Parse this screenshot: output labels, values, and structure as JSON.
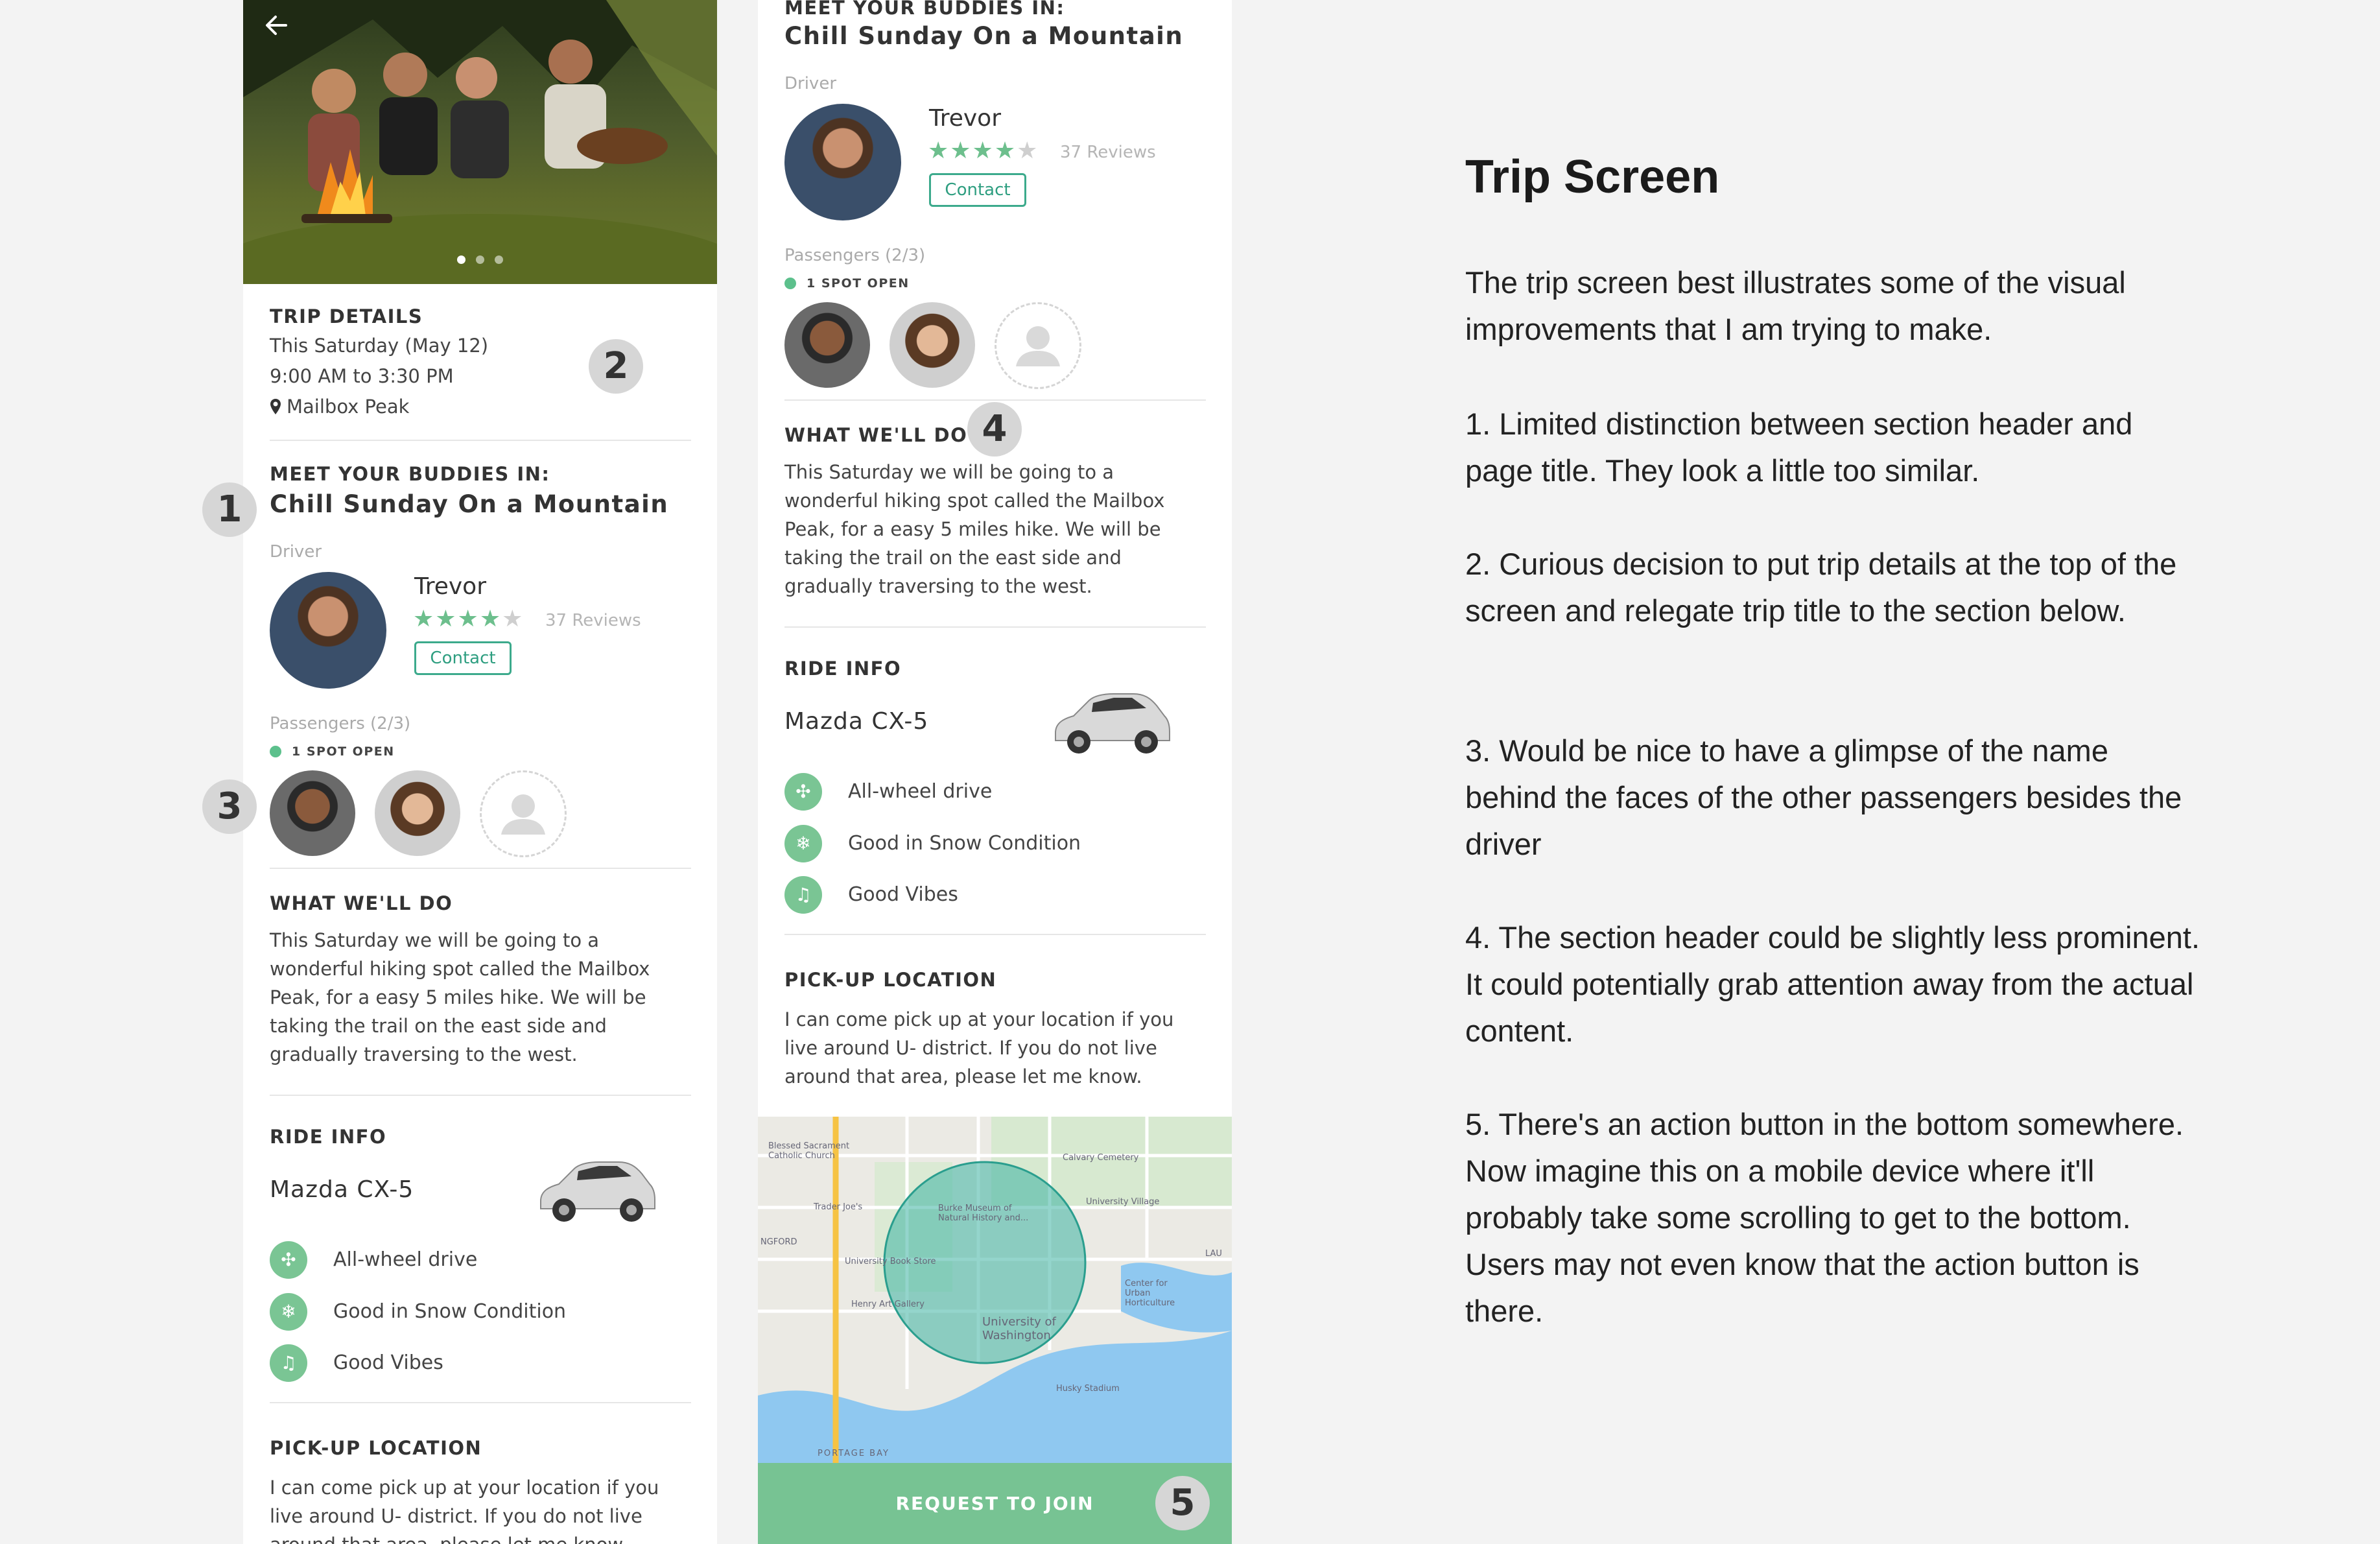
{
  "trip": {
    "details_header": "TRIP DETAILS",
    "date": "This Saturday (May 12)",
    "time": "9:00 AM to 3:30 PM",
    "location": "Mailbox Peak",
    "meet_header": "MEET YOUR BUDDIES IN:",
    "title": "Chill Sunday On a Mountain"
  },
  "driver": {
    "label": "Driver",
    "name": "Trevor",
    "stars_on": "★★★★",
    "stars_off": "★",
    "rating": 4,
    "reviews": "37 Reviews",
    "contact": "Contact"
  },
  "passengers": {
    "label": "Passengers (2/3)",
    "spot": "1 SPOT OPEN"
  },
  "what": {
    "header": "WHAT WE'LL DO",
    "lines": [
      "This Saturday we will be going to a",
      "wonderful hiking spot called the Mailbox",
      "Peak, for a easy 5 miles hike. We will be",
      "taking the trail on the east side and",
      "gradually traversing to the west."
    ]
  },
  "ride": {
    "header": "RIDE INFO",
    "car": "Mazda CX-5",
    "features": [
      "All-wheel drive",
      "Good in Snow Condition",
      "Good Vibes"
    ],
    "feature_icons": [
      "drive-icon",
      "snowflake-icon",
      "music-note-icon"
    ]
  },
  "pickup": {
    "header": "PICK-UP LOCATION",
    "lines": [
      "I can come pick up at your location if you",
      "live around U- district. If you do not live",
      "around that area, please let me know."
    ]
  },
  "map": {
    "labels": {
      "church": "Blessed Sacrament Catholic Church",
      "cemetery": "Calvary Cemetery",
      "traderjoes": "Trader Joe's",
      "burke": "Burke Museum of Natural History and...",
      "village": "University Village",
      "bookstore": "University Book Store",
      "henry": "Henry Art Gallery",
      "uw": "University of Washington",
      "center": "Center for Urban Horticulture",
      "husky": "Husky Stadium",
      "portage": "PORTAGE BAY",
      "ngford": "NGFORD",
      "lau": "LAU"
    }
  },
  "action": {
    "request": "REQUEST TO JOIN"
  },
  "badges": [
    "1",
    "2",
    "3",
    "4",
    "5"
  ],
  "notes": {
    "title": "Trip Screen",
    "intro": "The trip screen best illustrates some of the visual improvements that I am trying to make.",
    "items": [
      "1.  Limited distinction between section header and page title. They look a little too similar.",
      "2.  Curious decision to put trip details at the top of the screen and relegate trip title to the section below.",
      "3. Would be nice to have a glimpse of the name behind the faces of the other passengers besides the driver",
      "4. The section header could be slightly less prominent. It could potentially grab attention away from the actual content.",
      "5. There's an action button in the bottom somewhere. Now imagine this on a mobile device where it'll probably take some scrolling to get to the bottom. Users may not even know that the action button is there."
    ]
  },
  "colors": {
    "accent": "#77c393",
    "contact": "#3caa8c",
    "background": "#f3f3f3"
  }
}
